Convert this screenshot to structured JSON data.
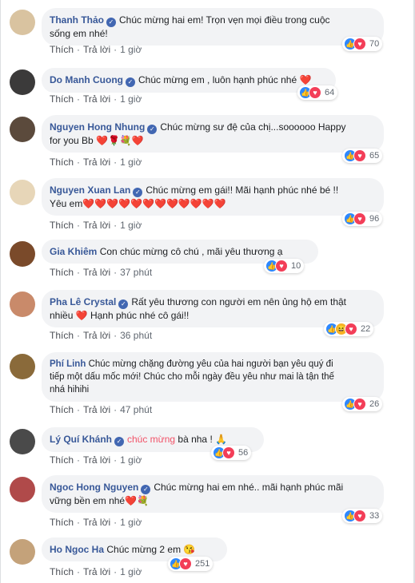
{
  "comments": [
    {
      "author": "Thanh Thảo",
      "line1": "Chúc mừng hai em! Trọn vẹn mọi điều trong cuộc",
      "line2": "sống em nhé!",
      "like": "Thích",
      "reply": "Trả lời",
      "time": "1 giờ",
      "count": "70",
      "avatar_color": "#d9c3a0"
    },
    {
      "author": "Do Manh Cuong",
      "line1": "Chúc mừng em , luôn hạnh phúc nhé ❤️",
      "line2": "",
      "like": "Thích",
      "reply": "Trả lời",
      "time": "1 giờ",
      "count": "64",
      "avatar_color": "#3b3a3a"
    },
    {
      "author": "Nguyen Hong Nhung",
      "line1": "Chúc mừng sư đệ của chị...soooooo Happy",
      "line2": "for you Bb ❤️🌹💐❤️",
      "like": "Thích",
      "reply": "Trả lời",
      "time": "1 giờ",
      "count": "65",
      "avatar_color": "#5b4a3c"
    },
    {
      "author": "Nguyen Xuan Lan",
      "line1": "Chúc mừng em gái!! Mãi hạnh phúc nhé bé !!",
      "line2": "Yêu em❤️❤️❤️❤️❤️❤️❤️❤️❤️❤️❤️❤️",
      "like": "Thích",
      "reply": "Trả lời",
      "time": "1 giờ",
      "count": "96",
      "avatar_color": "#e7d6b8"
    },
    {
      "author": "Gia Khiêm",
      "line1": "Con chúc mừng cô chú , mãi yêu thương ạ",
      "line2": "",
      "like": "Thích",
      "reply": "Trả lời",
      "time": "37 phút",
      "count": "10",
      "avatar_color": "#7a4a2a"
    },
    {
      "author": "Pha Lê Crystal",
      "line1": "Rất yêu thương con người em nên ủng hộ em thật",
      "line2": "nhiều ❤️ Hạnh phúc nhé cô gái!!",
      "like": "Thích",
      "reply": "Trả lời",
      "time": "36 phút",
      "count": "22",
      "avatar_color": "#c98a6a"
    },
    {
      "author": "Phí Linh",
      "line1": "Chúc mừng chặng đường yêu của hai người bạn yêu quý đi",
      "line2": "tiếp một dấu mốc mới! Chúc cho mỗi ngày đều yêu như mai là tận thế",
      "line3": "nhá hihihi",
      "like": "Thích",
      "reply": "Trả lời",
      "time": "47 phút",
      "count": "26",
      "avatar_color": "#8a6a3a"
    },
    {
      "author": "Lý Quí Khánh",
      "tag": "chúc mừng",
      "line1": "bà nha ! 🙏",
      "line2": "",
      "like": "Thích",
      "reply": "Trả lời",
      "time": "1 giờ",
      "count": "56",
      "avatar_color": "#4a4a4a"
    },
    {
      "author": "Ngoc Hong Nguyen",
      "line1": "Chúc mừng hai em nhé.. mãi hạnh phúc mãi",
      "line2": "vững bền em nhé❤️💐",
      "like": "Thích",
      "reply": "Trả lời",
      "time": "1 giờ",
      "count": "33",
      "avatar_color": "#b04a4a"
    },
    {
      "author": "Ho Ngoc Ha",
      "line1": "Chúc mừng 2 em 😘",
      "line2": "",
      "like": "Thích",
      "reply": "Trả lời",
      "time": "1 giờ",
      "count": "251",
      "avatar_color": "#c4a27a"
    }
  ],
  "colors": {
    "author": "#385898",
    "bubble": "#f2f3f5",
    "like_blue": "#2d88ff",
    "love_red": "#f33e58",
    "haha_yellow": "#f7b125"
  }
}
